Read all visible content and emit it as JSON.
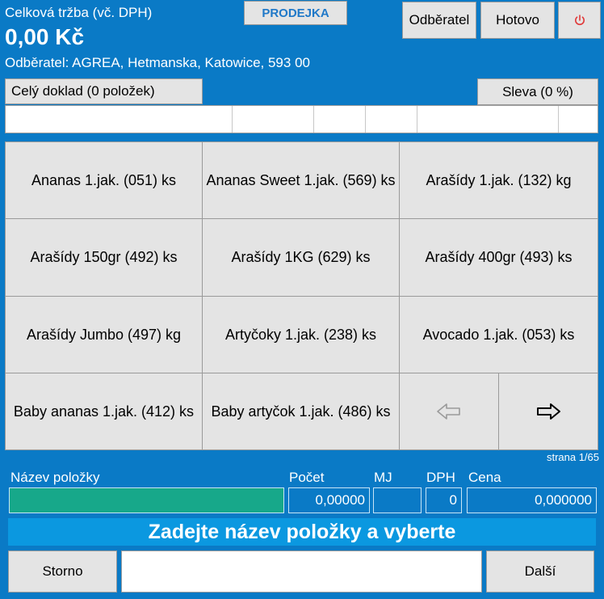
{
  "header": {
    "total_label": "Celková tržba (vč. DPH)",
    "total_value": "0,00 Kč",
    "customer_line": "Odběratel: AGREA, Hetmanska, Katowice, 593 00",
    "mode_label": "PRODEJKA",
    "customer_button": "Odběratel",
    "done_button": "Hotovo",
    "power_icon": "power-icon"
  },
  "document": {
    "whole_doc_label": "Celý doklad (0 položek)",
    "discount_button": "Sleva (0 %)"
  },
  "products": [
    [
      "Ananas 1.jak. (051) ks",
      "Ananas Sweet 1.jak. (569) ks",
      "Arašídy 1.jak. (132) kg"
    ],
    [
      "Arašídy 150gr (492) ks",
      "Arašídy 1KG (629) ks",
      "Arašídy 400gr (493) ks"
    ],
    [
      "Arašídy Jumbo (497) kg",
      "Artyčoky 1.jak. (238) ks",
      "Avocado 1.jak. (053) ks"
    ],
    [
      "Baby ananas 1.jak. (412) ks",
      "Baby artyčok 1.jak. (486) ks"
    ]
  ],
  "pager": {
    "page_label": "strana 1/65",
    "prev_icon": "arrow-left-icon",
    "next_icon": "arrow-right-icon"
  },
  "entry": {
    "name_label": "Název položky",
    "qty_label": "Počet",
    "unit_label": "MJ",
    "vat_label": "DPH",
    "price_label": "Cena",
    "name_value": "",
    "qty_value": "0,00000",
    "unit_value": "",
    "vat_value": "0",
    "price_value": "0,000000"
  },
  "instruction": "Zadejte název položky a vyberte",
  "footer": {
    "storno_button": "Storno",
    "input_value": "",
    "next_button": "Další"
  },
  "colors": {
    "background": "#0a7ac6",
    "banner": "#0b98e0",
    "name_field": "#17a88a",
    "buttons": "#e4e4e4",
    "mode_text": "#1f78c8",
    "power": "#e03a3a"
  }
}
